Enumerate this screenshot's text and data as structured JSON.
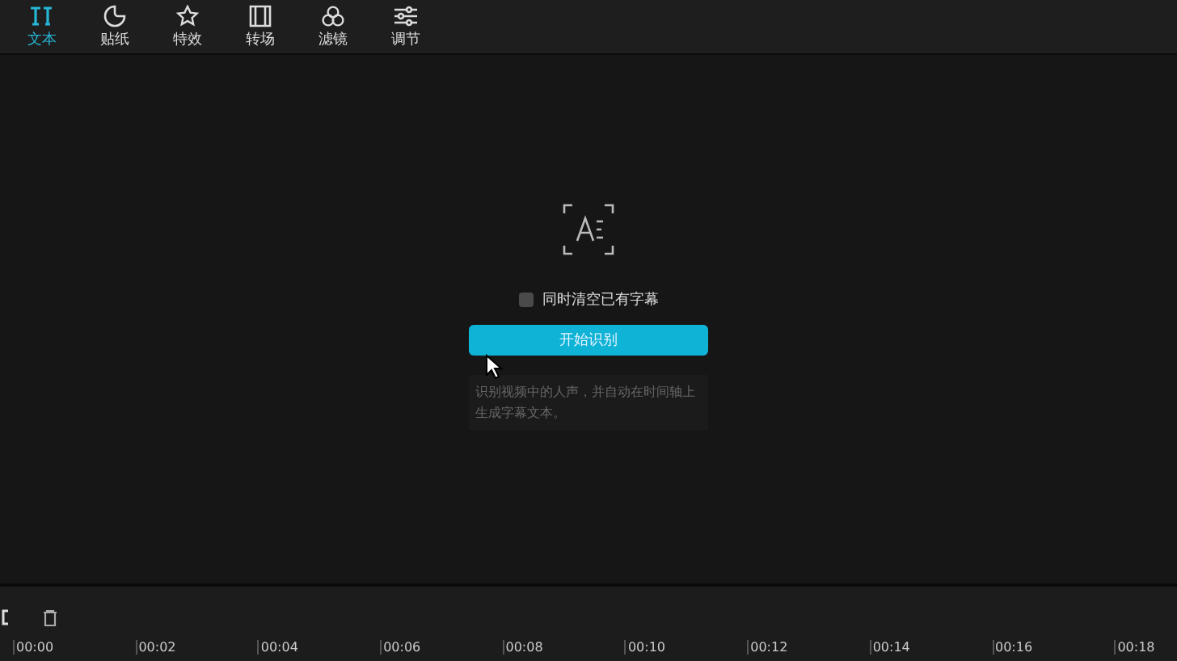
{
  "tabs": [
    {
      "label": "文本",
      "selected": true
    },
    {
      "label": "贴纸",
      "selected": false
    },
    {
      "label": "特效",
      "selected": false
    },
    {
      "label": "转场",
      "selected": false
    },
    {
      "label": "滤镜",
      "selected": false
    },
    {
      "label": "调节",
      "selected": false
    }
  ],
  "recognition": {
    "checkbox": {
      "label": "同时清空已有字幕",
      "checked": false
    },
    "button": "开始识别",
    "description": "识别视频中的人声，并自动在时间轴上生成字幕文本。"
  },
  "timeline": {
    "ticks": [
      "00:00",
      "00:02",
      "00:04",
      "00:06",
      "00:08",
      "00:10",
      "00:12",
      "00:14",
      "00:16",
      "00:18"
    ]
  }
}
